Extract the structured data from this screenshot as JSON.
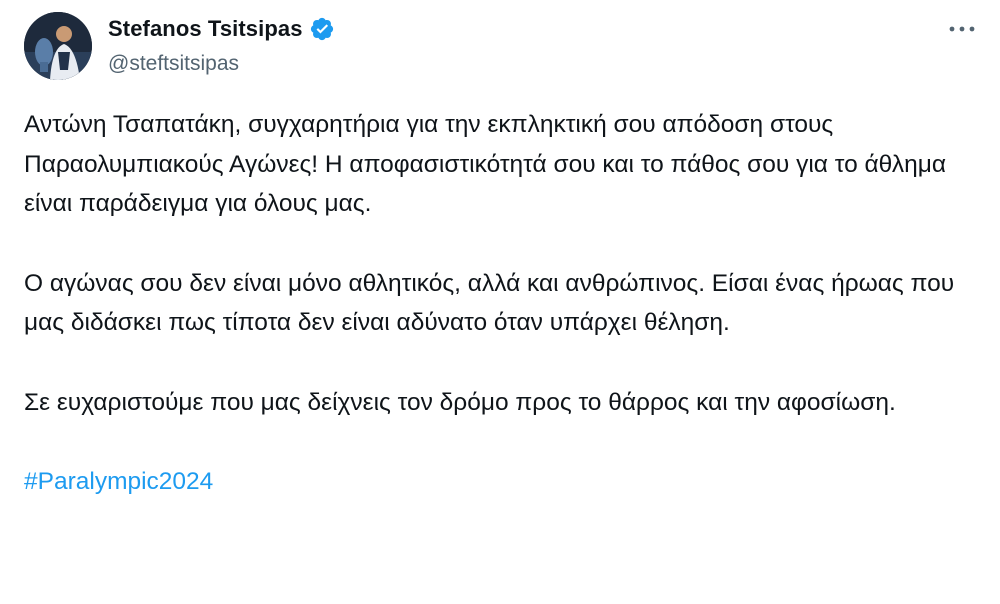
{
  "author": {
    "display_name": "Stefanos Tsitsipas",
    "handle": "@steftsitsipas",
    "verified": true,
    "avatar_icon": "profile-photo"
  },
  "menu": {
    "icon": "more-options-icon",
    "glyph": "···"
  },
  "tweet": {
    "paragraphs": [
      "Αντώνη Τσαπατάκη, συγχαρητήρια για την εκπληκτική σου απόδοση στους Παραολυμπιακούς Αγώνες! Η αποφασιστικότητά σου και το πάθος σου για το άθλημα είναι παράδειγμα για όλους μας.",
      "Ο αγώνας σου δεν είναι μόνο αθλητικός, αλλά και ανθρώπινος. Είσαι ένας ήρωας που μας διδάσκει πως τίποτα δεν είναι αδύνατο όταν υπάρχει θέληση.",
      "Σε ευχαριστούμε που μας δείχνεις τον δρόμο προς το θάρρος και την αφοσίωση."
    ],
    "hashtag": "#Paralympic2024"
  },
  "colors": {
    "text": "#0f1419",
    "secondary": "#536471",
    "accent": "#1d9bf0"
  }
}
